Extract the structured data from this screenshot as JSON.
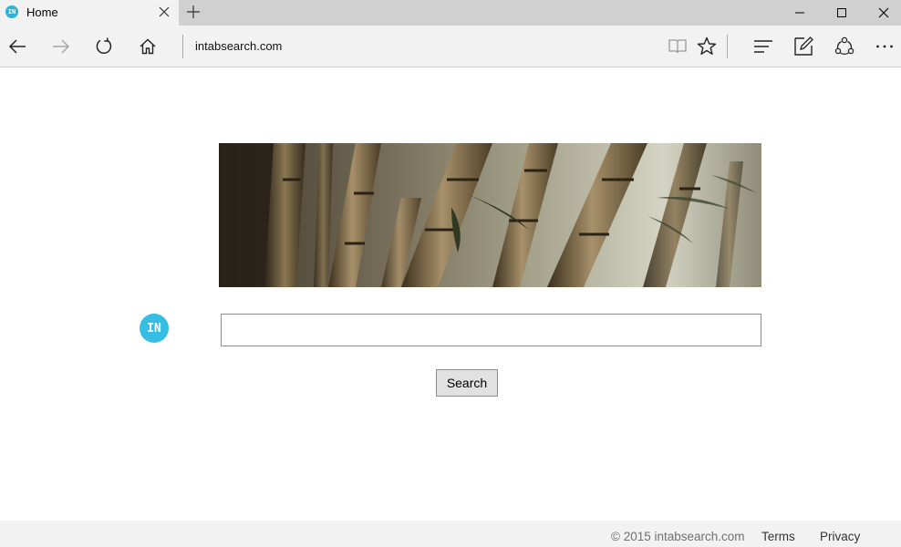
{
  "browser": {
    "tab": {
      "title": "Home",
      "favicon_text": "IN"
    },
    "address": "intabsearch.com",
    "icons": {
      "back": "arrow-left-icon",
      "forward": "arrow-right-icon",
      "refresh": "refresh-icon",
      "home": "home-icon",
      "reading_view": "book-icon",
      "favorite": "star-icon",
      "hub": "hub-lines-icon",
      "web_note": "pen-note-icon",
      "share": "share-icon",
      "more": "more-dots-icon"
    }
  },
  "page": {
    "logo_text": "IN",
    "search": {
      "value": "",
      "placeholder": "",
      "button_label": "Search"
    },
    "footer": {
      "copyright": "© 2015 intabsearch.com",
      "links": [
        "Terms",
        "Privacy"
      ]
    }
  },
  "colors": {
    "accent": "#35bde2",
    "chrome": "#f2f2f2",
    "titlebar": "#d0d0d0"
  }
}
